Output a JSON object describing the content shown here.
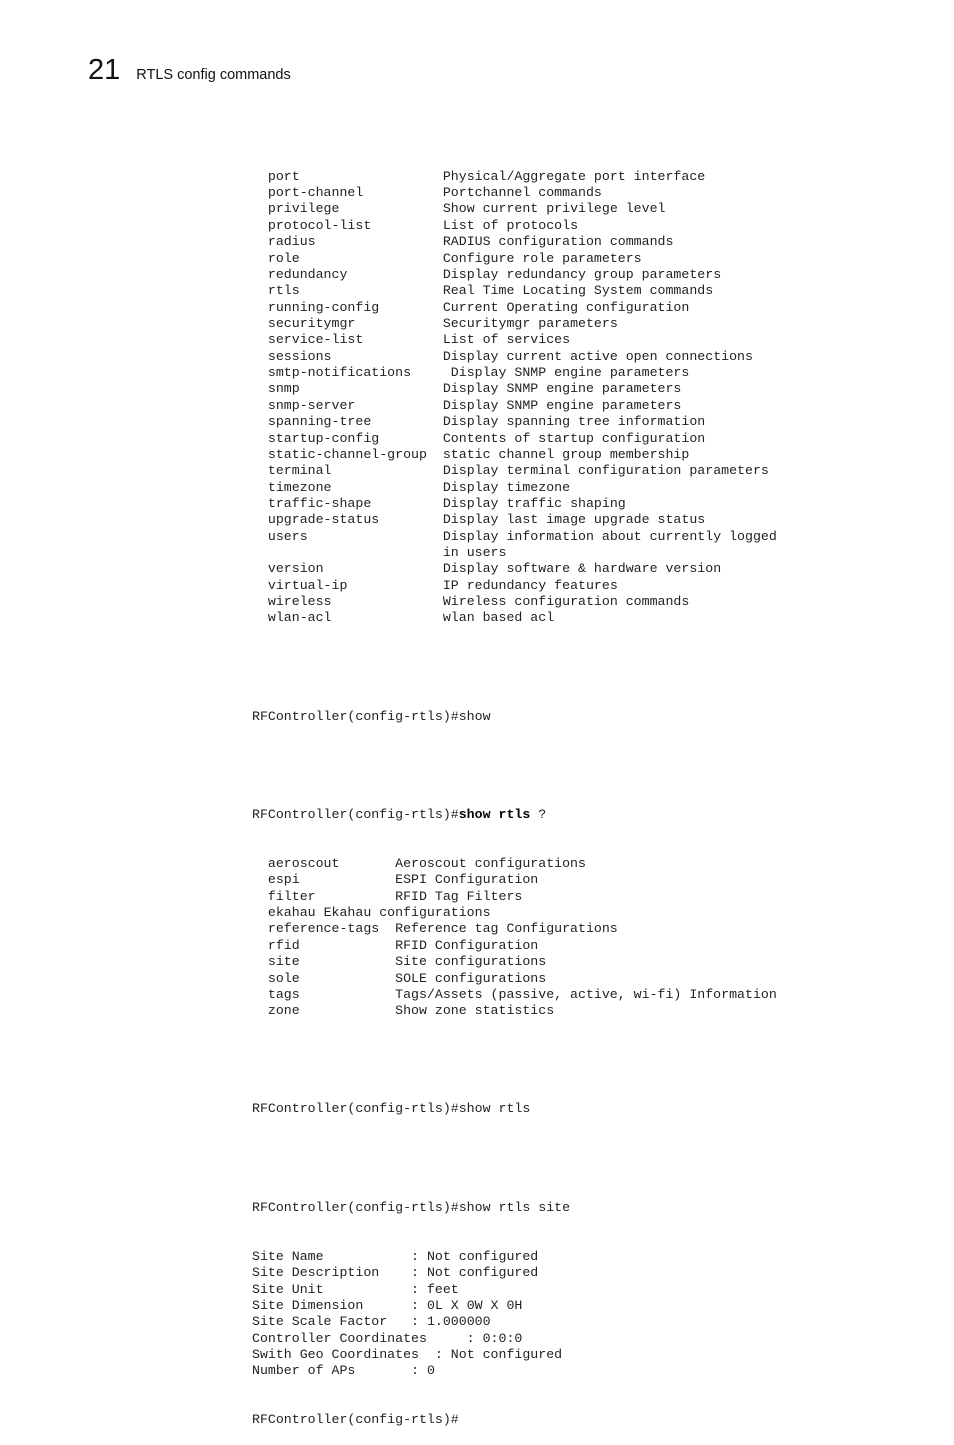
{
  "header": {
    "chapter_number": "21",
    "chapter_title": "RTLS config commands"
  },
  "show_options": [
    {
      "cmd": "port",
      "desc": "Physical/Aggregate port interface"
    },
    {
      "cmd": "port-channel",
      "desc": "Portchannel commands"
    },
    {
      "cmd": "privilege",
      "desc": "Show current privilege level"
    },
    {
      "cmd": "protocol-list",
      "desc": "List of protocols"
    },
    {
      "cmd": "radius",
      "desc": "RADIUS configuration commands"
    },
    {
      "cmd": "role",
      "desc": "Configure role parameters"
    },
    {
      "cmd": "redundancy",
      "desc": "Display redundancy group parameters"
    },
    {
      "cmd": "rtls",
      "desc": "Real Time Locating System commands"
    },
    {
      "cmd": "running-config",
      "desc": "Current Operating configuration"
    },
    {
      "cmd": "securitymgr",
      "desc": "Securitymgr parameters"
    },
    {
      "cmd": "service-list",
      "desc": "List of services"
    },
    {
      "cmd": "sessions",
      "desc": "Display current active open connections"
    },
    {
      "cmd": "smtp-notifications",
      "desc": " Display SNMP engine parameters"
    },
    {
      "cmd": "snmp",
      "desc": "Display SNMP engine parameters"
    },
    {
      "cmd": "snmp-server",
      "desc": "Display SNMP engine parameters"
    },
    {
      "cmd": "spanning-tree",
      "desc": "Display spanning tree information"
    },
    {
      "cmd": "startup-config",
      "desc": "Contents of startup configuration"
    },
    {
      "cmd": "static-channel-group",
      "desc": "static channel group membership"
    },
    {
      "cmd": "terminal",
      "desc": "Display terminal configuration parameters"
    },
    {
      "cmd": "timezone",
      "desc": "Display timezone"
    },
    {
      "cmd": "traffic-shape",
      "desc": "Display traffic shaping"
    },
    {
      "cmd": "upgrade-status",
      "desc": "Display last image upgrade status"
    },
    {
      "cmd": "users",
      "desc": "Display information about currently logged"
    },
    {
      "cmd": "",
      "desc": "in users"
    },
    {
      "cmd": "version",
      "desc": "Display software & hardware version"
    },
    {
      "cmd": "virtual-ip",
      "desc": "IP redundancy features"
    },
    {
      "cmd": "wireless",
      "desc": "Wireless configuration commands"
    },
    {
      "cmd": "wlan-acl",
      "desc": "wlan based acl"
    }
  ],
  "prompt": "RFController(config-rtls)#",
  "cmd_show": "show",
  "cmd_show_rtls_help": {
    "bold": "show rtls",
    "suffix": " ?"
  },
  "rtls_options": [
    {
      "cmd": "aeroscout",
      "desc": "Aeroscout configurations"
    },
    {
      "cmd": "espi",
      "desc": "ESPI Configuration"
    },
    {
      "cmd": "filter",
      "desc": "RFID Tag Filters"
    },
    {
      "cmd": "ekahau",
      "desc": "Ekahau configurations",
      "inline": true
    },
    {
      "cmd": "reference-tags",
      "desc": "Reference tag Configurations"
    },
    {
      "cmd": "rfid",
      "desc": "RFID Configuration"
    },
    {
      "cmd": "site",
      "desc": "Site configurations"
    },
    {
      "cmd": "sole",
      "desc": "SOLE configurations"
    },
    {
      "cmd": "tags",
      "desc": "Tags/Assets (passive, active, wi-fi) Information"
    },
    {
      "cmd": "zone",
      "desc": "Show zone statistics"
    }
  ],
  "cmd_show_rtls": "show rtls",
  "cmd_show_rtls_site": "show rtls site",
  "site_info": [
    {
      "label": "Site Name",
      "sep": "           : ",
      "value": "Not configured"
    },
    {
      "label": "Site Description",
      "sep": "    : ",
      "value": "Not configured"
    },
    {
      "label": "Site Unit",
      "sep": "           : ",
      "value": "feet"
    },
    {
      "label": "Site Dimension",
      "sep": "      : ",
      "value": "0L X 0W X 0H"
    },
    {
      "label": "Site Scale Factor",
      "sep": "   : ",
      "value": "1.000000"
    },
    {
      "label": "Controller Coordinates",
      "sep": "     : ",
      "value": "0:0:0"
    },
    {
      "label": "Swith Geo Coordinates",
      "sep": "  : ",
      "value": "Not configured"
    },
    {
      "label": "Number of APs",
      "sep": "       : ",
      "value": "0"
    }
  ]
}
